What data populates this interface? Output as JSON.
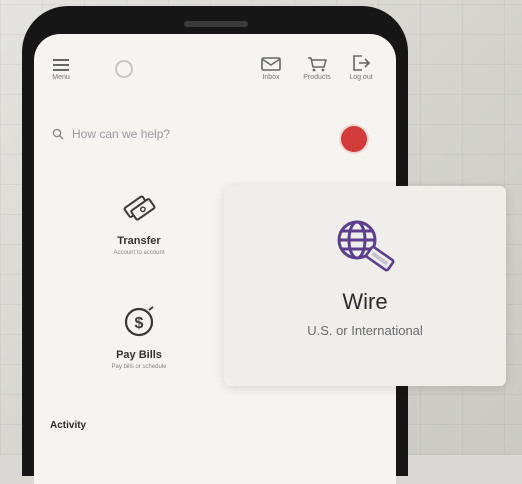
{
  "nav": {
    "menu_label": "Menu",
    "inbox_label": "Inbox",
    "products_label": "Products",
    "logout_label": "Log out"
  },
  "search": {
    "placeholder": "How can we help?"
  },
  "actions": [
    {
      "title": "Transfer",
      "subtitle": "Account to account",
      "icon": "transfer-icon"
    },
    {
      "title": "Pay Bills",
      "subtitle": "Pay bills or schedule",
      "icon": "pay-bills-icon"
    }
  ],
  "activity": {
    "heading": "Activity"
  },
  "wire": {
    "title": "Wire",
    "subtitle": "U.S. or International",
    "icon": "globe-wire-icon"
  },
  "colors": {
    "accent": "#5b3f8c",
    "chat": "#d33a3a"
  }
}
